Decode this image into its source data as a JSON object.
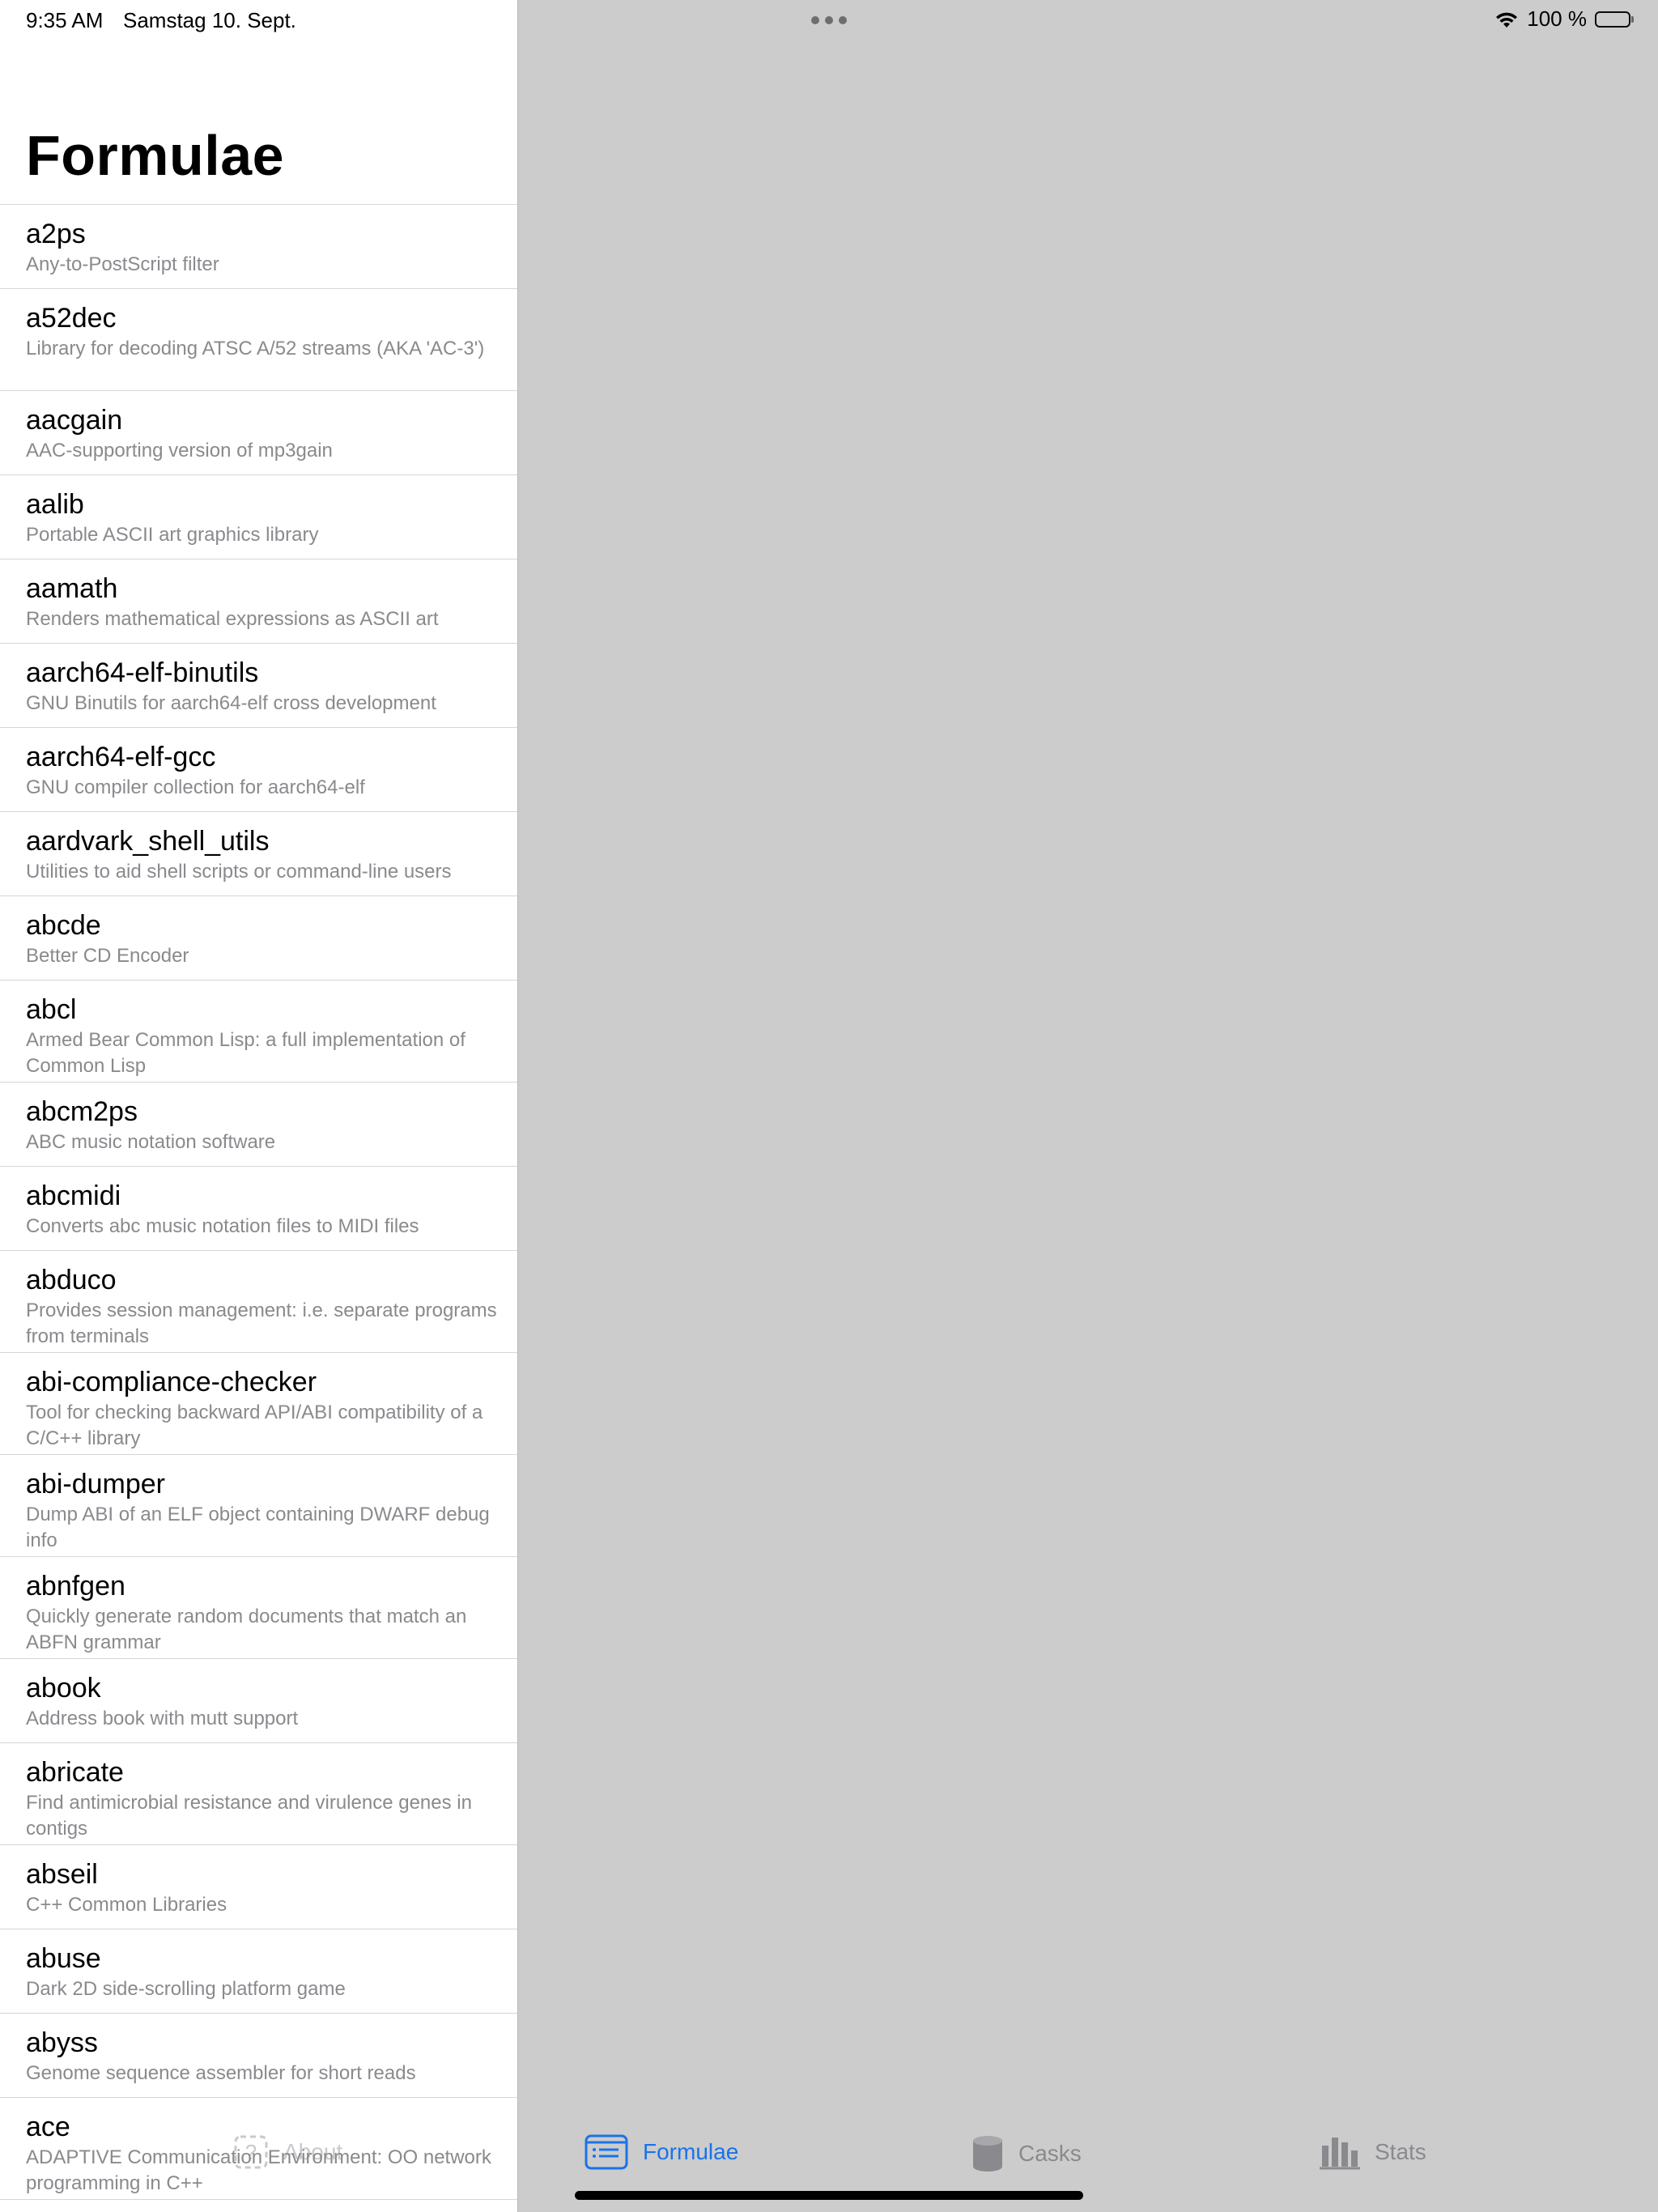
{
  "status_bar": {
    "time": "9:35 AM",
    "date": "Samstag 10. Sept.",
    "battery": "100 %",
    "battery_level": 1.0,
    "icons": [
      "wifi-icon",
      "battery-icon",
      "more-dots-icon"
    ]
  },
  "sidebar": {
    "title": "Formulae",
    "items": [
      {
        "name": "a2ps",
        "desc": "Any-to-PostScript filter"
      },
      {
        "name": "a52dec",
        "desc": "Library for decoding ATSC A/52 streams (AKA 'AC-3')"
      },
      {
        "name": "aacgain",
        "desc": "AAC-supporting version of mp3gain"
      },
      {
        "name": "aalib",
        "desc": "Portable ASCII art graphics library"
      },
      {
        "name": "aamath",
        "desc": "Renders mathematical expressions as ASCII art"
      },
      {
        "name": "aarch64-elf-binutils",
        "desc": "GNU Binutils for aarch64-elf cross development"
      },
      {
        "name": "aarch64-elf-gcc",
        "desc": "GNU compiler collection for aarch64-elf"
      },
      {
        "name": "aardvark_shell_utils",
        "desc": "Utilities to aid shell scripts or command-line users"
      },
      {
        "name": "abcde",
        "desc": "Better CD Encoder"
      },
      {
        "name": "abcl",
        "desc": "Armed Bear Common Lisp: a full implementation of Common Lisp"
      },
      {
        "name": "abcm2ps",
        "desc": "ABC music notation software"
      },
      {
        "name": "abcmidi",
        "desc": "Converts abc music notation files to MIDI files"
      },
      {
        "name": "abduco",
        "desc": "Provides session management: i.e. separate programs from terminals"
      },
      {
        "name": "abi-compliance-checker",
        "desc": "Tool for checking backward API/ABI compatibility of a C/C++ library"
      },
      {
        "name": "abi-dumper",
        "desc": "Dump ABI of an ELF object containing DWARF debug info"
      },
      {
        "name": "abnfgen",
        "desc": "Quickly generate random documents that match an ABFN grammar"
      },
      {
        "name": "abook",
        "desc": "Address book with mutt support"
      },
      {
        "name": "abricate",
        "desc": "Find antimicrobial resistance and virulence genes in contigs"
      },
      {
        "name": "abseil",
        "desc": "C++ Common Libraries"
      },
      {
        "name": "abuse",
        "desc": "Dark 2D side-scrolling platform game"
      },
      {
        "name": "abyss",
        "desc": "Genome sequence assembler for short reads"
      },
      {
        "name": "ace",
        "desc": "ADAPTIVE Communication Environment: OO network programming in C++"
      }
    ]
  },
  "tabbar": {
    "about": {
      "label": "About",
      "icon": "question-icon"
    },
    "formulae": {
      "label": "Formulae",
      "icon": "list-icon",
      "selected": true
    },
    "casks": {
      "label": "Casks",
      "icon": "cylinder-icon"
    },
    "stats": {
      "label": "Stats",
      "icon": "bar-chart-icon"
    }
  },
  "colors": {
    "accent": "#1a73e8",
    "detail_background": "#cccccc",
    "secondary_text": "#8a8a8e",
    "separator": "#d6d6d6"
  }
}
